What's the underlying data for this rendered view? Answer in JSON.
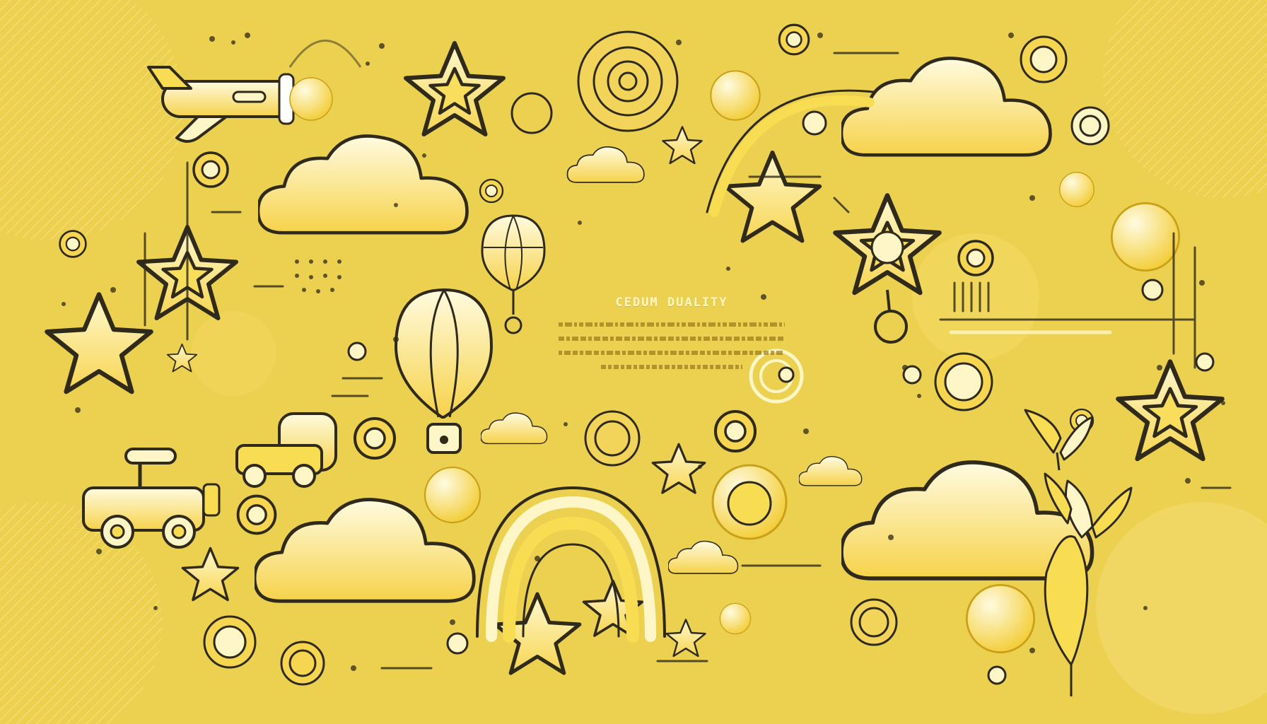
{
  "banner": {
    "title": "CEDUM DUALITY"
  },
  "colors": {
    "background": "#ecd150",
    "fill_light": "#fff3b0",
    "fill_mid": "#f8dc52",
    "outline": "#2f2a1a",
    "highlight": "#fffbe6"
  },
  "illustration": {
    "icons": [
      "airplane-icon",
      "toy-car-icon",
      "hot-air-balloon-icon",
      "cloud-icon",
      "star-icon",
      "rainbow-icon",
      "ring-icon",
      "sun-flower-icon",
      "leaf-plant-icon"
    ]
  }
}
